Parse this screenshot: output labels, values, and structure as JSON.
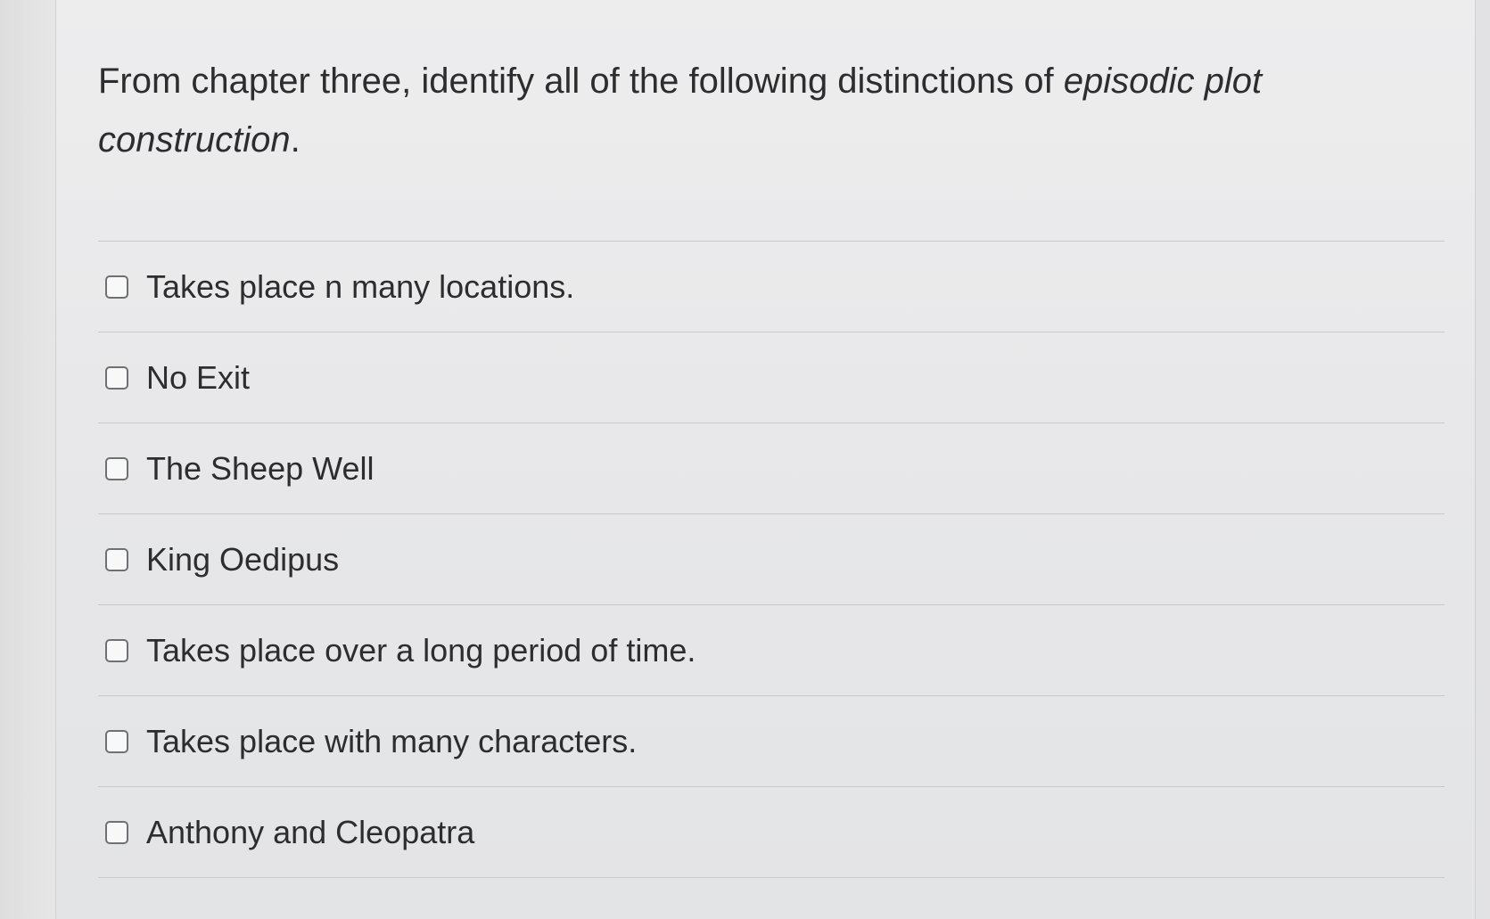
{
  "question": {
    "text_before": "From chapter three, identify all of the following distinctions of ",
    "emphasis": "episodic plot construction",
    "text_after": "."
  },
  "answers": [
    {
      "label": "Takes place n many locations.",
      "checked": false
    },
    {
      "label": "No Exit",
      "checked": false
    },
    {
      "label": "The Sheep Well",
      "checked": false
    },
    {
      "label": "King Oedipus",
      "checked": false
    },
    {
      "label": "Takes place over a long period of time.",
      "checked": false
    },
    {
      "label": "Takes place with many characters.",
      "checked": false
    },
    {
      "label": "Anthony and Cleopatra",
      "checked": false
    }
  ]
}
